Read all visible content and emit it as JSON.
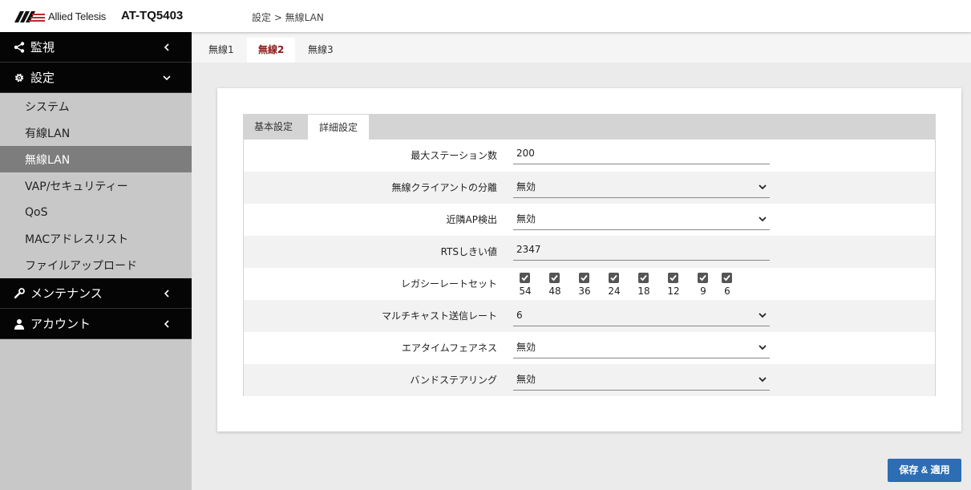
{
  "header": {
    "logo_text": "Allied Telesis",
    "model": "AT-TQ5403",
    "breadcrumb": "設定 > 無線LAN"
  },
  "sidebar": {
    "groups": [
      {
        "label": "監視",
        "icon": "share-icon",
        "expanded": false
      },
      {
        "label": "設定",
        "icon": "gear-icon",
        "expanded": true
      },
      {
        "label": "メンテナンス",
        "icon": "wrench-icon",
        "expanded": false
      },
      {
        "label": "アカウント",
        "icon": "user-icon",
        "expanded": false
      }
    ],
    "sub_items": [
      {
        "label": "システム",
        "active": false
      },
      {
        "label": "有線LAN",
        "active": false
      },
      {
        "label": "無線LAN",
        "active": true
      },
      {
        "label": "VAP/セキュリティー",
        "active": false
      },
      {
        "label": "QoS",
        "active": false
      },
      {
        "label": "MACアドレスリスト",
        "active": false
      },
      {
        "label": "ファイルアップロード",
        "active": false
      }
    ]
  },
  "radio_tabs": [
    {
      "label": "無線1",
      "active": false
    },
    {
      "label": "無線2",
      "active": true
    },
    {
      "label": "無線3",
      "active": false
    }
  ],
  "settings_tabs": [
    {
      "label": "基本設定",
      "active": false
    },
    {
      "label": "詳細設定",
      "active": true
    }
  ],
  "form": {
    "max_stations": {
      "label": "最大ステーション数",
      "value": "200"
    },
    "client_isolation": {
      "label": "無線クライアントの分離",
      "value": "無効"
    },
    "neighbor_ap_detect": {
      "label": "近隣AP検出",
      "value": "無効"
    },
    "rts_threshold": {
      "label": "RTSしきい値",
      "value": "2347"
    },
    "legacy_rate_set": {
      "label": "レガシーレートセット",
      "rates": [
        {
          "label": "54",
          "checked": true
        },
        {
          "label": "48",
          "checked": true
        },
        {
          "label": "36",
          "checked": true
        },
        {
          "label": "24",
          "checked": true
        },
        {
          "label": "18",
          "checked": true
        },
        {
          "label": "12",
          "checked": true
        },
        {
          "label": "9",
          "checked": true
        },
        {
          "label": "6",
          "checked": true
        }
      ]
    },
    "multicast_rate": {
      "label": "マルチキャスト送信レート",
      "value": "6"
    },
    "airtime_fairness": {
      "label": "エアタイムフェアネス",
      "value": "無効"
    },
    "band_steering": {
      "label": "バンドステアリング",
      "value": "無効"
    }
  },
  "save_button": {
    "label": "保存 & 適用"
  },
  "colors": {
    "accent_blue": "#2d6db3",
    "active_tab_text": "#8b1a1a",
    "sidebar_dark": "#050505",
    "sidebar_active": "#7d7d7d"
  }
}
